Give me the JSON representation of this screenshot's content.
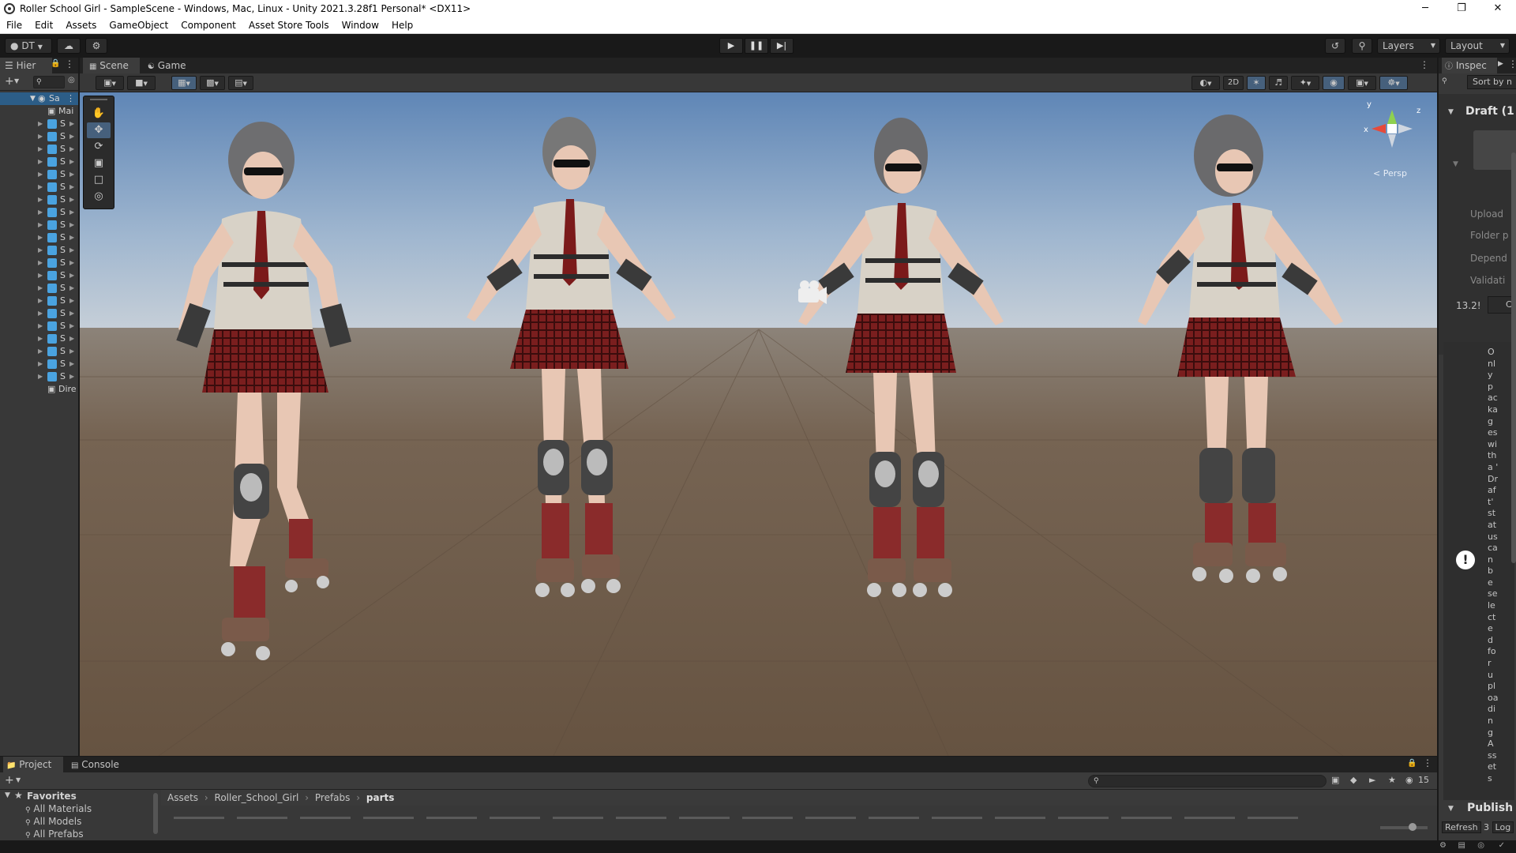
{
  "window": {
    "title": "Roller School Girl - SampleScene - Windows, Mac, Linux - Unity 2021.3.28f1 Personal* <DX11>",
    "minimize": "─",
    "maximize": "❐",
    "close": "✕"
  },
  "menu": [
    "File",
    "Edit",
    "Assets",
    "GameObject",
    "Component",
    "Asset Store Tools",
    "Window",
    "Help"
  ],
  "toolbar": {
    "account_label": "DT",
    "layers_label": "Layers",
    "layout_label": "Layout"
  },
  "hierarchy": {
    "tab_label": "Hier",
    "scene_label": "Sa",
    "rows": [
      {
        "label": "Mai",
        "type": "object"
      },
      {
        "label": "S",
        "type": "prefab"
      },
      {
        "label": "S",
        "type": "prefab"
      },
      {
        "label": "S",
        "type": "prefab"
      },
      {
        "label": "S",
        "type": "prefab"
      },
      {
        "label": "S",
        "type": "prefab"
      },
      {
        "label": "S",
        "type": "prefab"
      },
      {
        "label": "S",
        "type": "prefab"
      },
      {
        "label": "S",
        "type": "prefab"
      },
      {
        "label": "S",
        "type": "prefab"
      },
      {
        "label": "S",
        "type": "prefab"
      },
      {
        "label": "S",
        "type": "prefab"
      },
      {
        "label": "S",
        "type": "prefab"
      },
      {
        "label": "S",
        "type": "prefab"
      },
      {
        "label": "S",
        "type": "prefab"
      },
      {
        "label": "S",
        "type": "prefab"
      },
      {
        "label": "S",
        "type": "prefab"
      },
      {
        "label": "S",
        "type": "prefab"
      },
      {
        "label": "S",
        "type": "prefab"
      },
      {
        "label": "S",
        "type": "prefab"
      },
      {
        "label": "S",
        "type": "prefab"
      },
      {
        "label": "S",
        "type": "prefab"
      },
      {
        "label": "Dire",
        "type": "object"
      }
    ]
  },
  "scene": {
    "tabs": {
      "scene": "Scene",
      "game": "Game"
    },
    "toggle_2d": "2D",
    "persp_label": "< Persp",
    "gizmo_axes": {
      "x": "x",
      "y": "y",
      "z": "z"
    }
  },
  "inspector": {
    "tab_label": "Inspec",
    "sort_label": "Sort by n",
    "draft_title": "Draft (1",
    "fields": [
      "Upload",
      "Folder p",
      "Depend",
      "Validati"
    ],
    "value": "13.2!",
    "value_btn": "C",
    "message_lines": [
      "O",
      "nl",
      "y",
      "p",
      "ac",
      "ka",
      "g",
      "es",
      "wi",
      "th",
      "a '",
      "Dr",
      "af",
      "t'",
      "st",
      "at",
      "us",
      "ca",
      "n",
      "b",
      "e",
      "se",
      "le",
      "ct",
      "e",
      "d",
      "fo",
      "r",
      "u",
      "pl",
      "oa",
      "di",
      "n",
      "g",
      "A",
      "ss",
      "et",
      "s"
    ],
    "publish_label": "Publish",
    "refresh_label": "Refresh",
    "refresh_count": "3",
    "log_label": "Log"
  },
  "project": {
    "tabs": {
      "project": "Project",
      "console": "Console"
    },
    "favorites_label": "Favorites",
    "favorites": [
      "All Materials",
      "All Models",
      "All Prefabs"
    ],
    "breadcrumb": [
      "Assets",
      "Roller_School_Girl",
      "Prefabs",
      "parts"
    ],
    "hidden_count": "15"
  },
  "colors": {
    "accent": "#46607c",
    "prefab_blue": "#4aa3e0",
    "sky_top": "#6f93bd",
    "ground": "#6c5b4b"
  }
}
